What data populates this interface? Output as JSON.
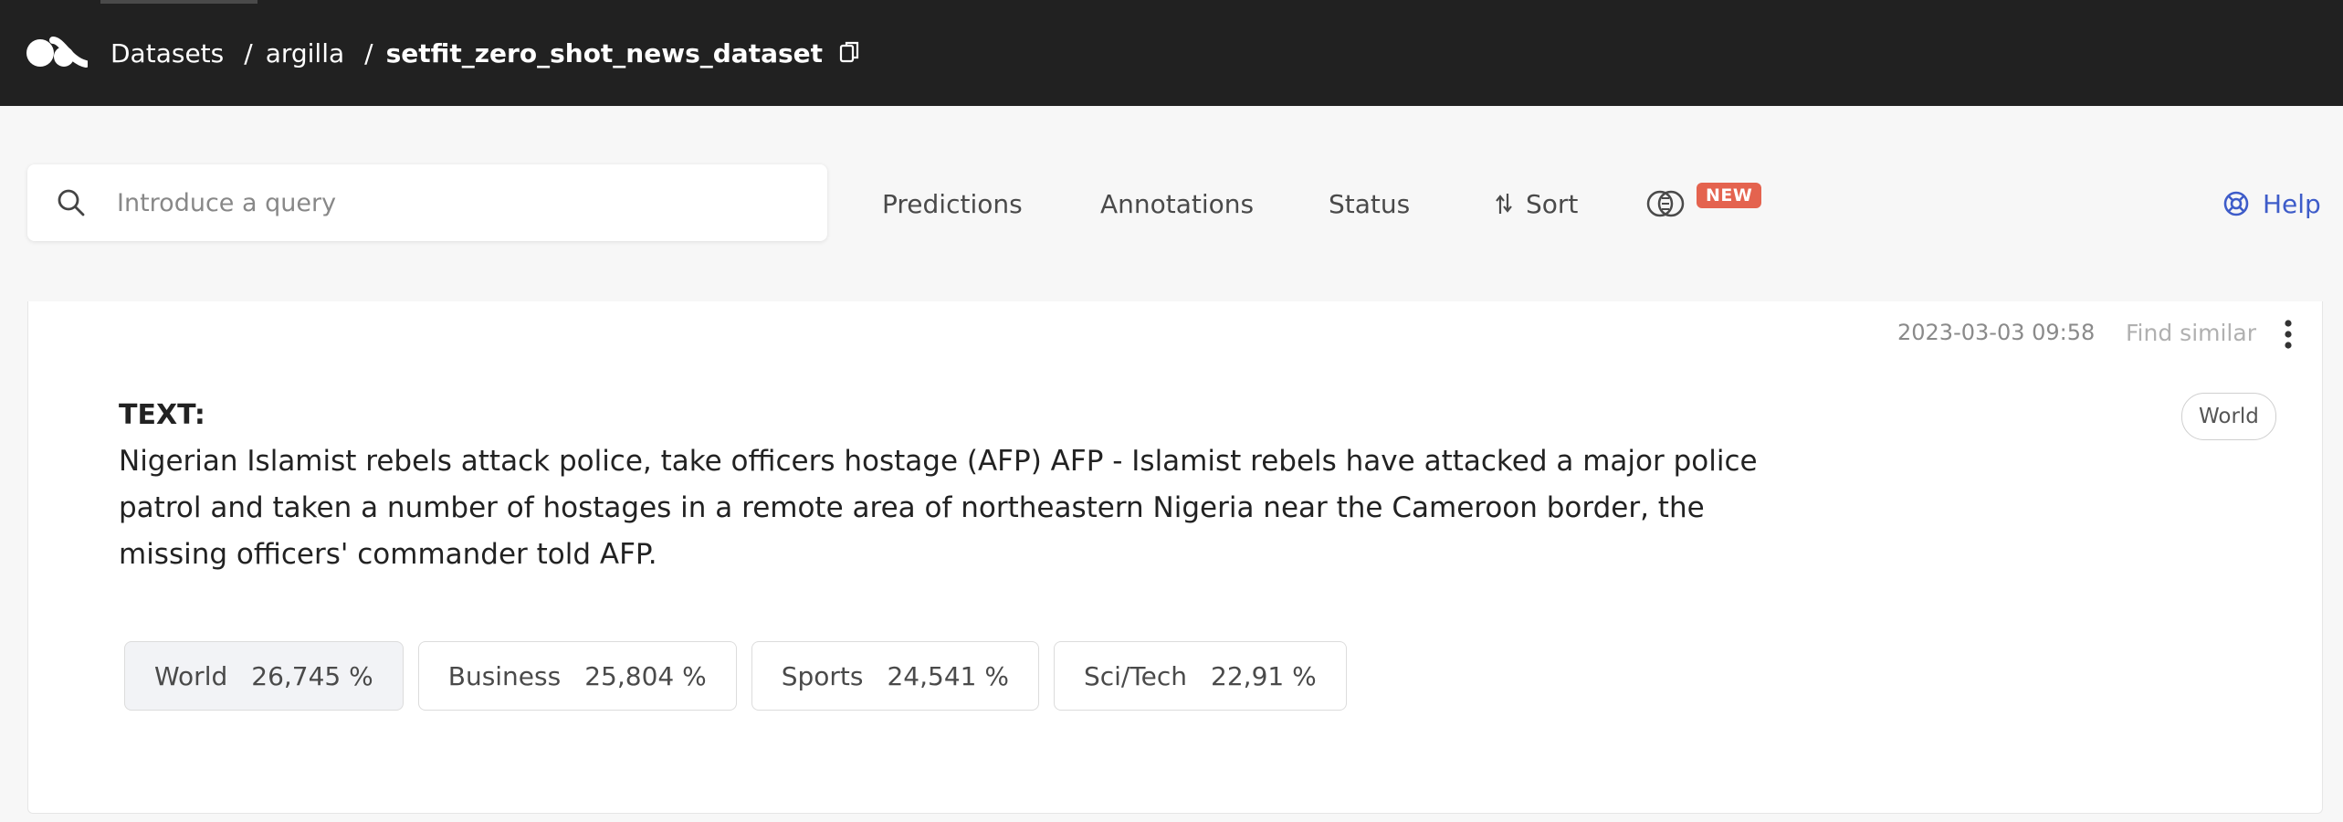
{
  "topbar": {
    "breadcrumbs": [
      {
        "label": "Datasets"
      },
      {
        "label": "argilla"
      },
      {
        "label": "setfit_zero_shot_news_dataset"
      }
    ],
    "separator": "/"
  },
  "search": {
    "placeholder": "Introduce a query",
    "value": ""
  },
  "filters": {
    "predictions": "Predictions",
    "annotations": "Annotations",
    "status": "Status",
    "sort": "Sort",
    "new_badge": "NEW",
    "help": "Help"
  },
  "record": {
    "timestamp": "2023-03-03 09:58",
    "find_similar": "Find similar",
    "annotation_label": "World",
    "text_label": "TEXT:",
    "text": "Nigerian Islamist rebels attack police, take officers hostage (AFP) AFP - Islamist rebels have attacked a major police patrol and taken a number of hostages in a remote area of northeastern Nigeria near the Cameroon border, the missing officers' commander told AFP.",
    "predictions": [
      {
        "label": "World",
        "score": "26,745 %"
      },
      {
        "label": "Business",
        "score": "25,804 %"
      },
      {
        "label": "Sports",
        "score": "24,541 %"
      },
      {
        "label": "Sci/Tech",
        "score": "22,91 %"
      }
    ]
  },
  "colors": {
    "topbar": "#212121",
    "accent": "#3e5cc9",
    "badge": "#e4634f",
    "selected_prediction": "#f2f3f6"
  },
  "icons": [
    "argilla-logo-icon",
    "copy-icon",
    "search-icon",
    "sort-icon",
    "similarity-icon",
    "help-icon",
    "kebab-menu-icon"
  ]
}
